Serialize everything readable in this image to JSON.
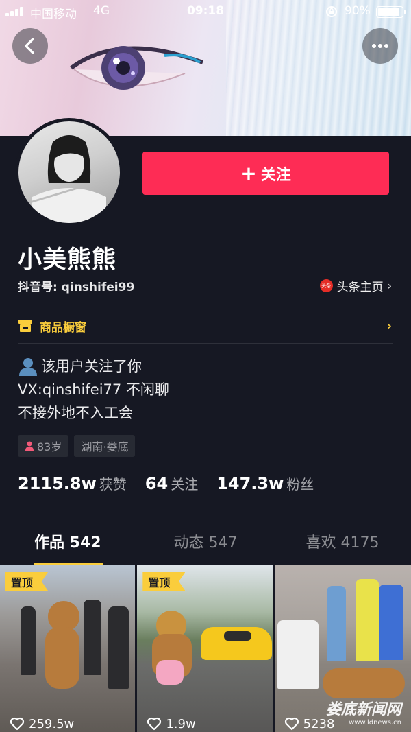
{
  "status_bar": {
    "carrier": "中国移动",
    "network": "4G",
    "time": "09:18",
    "battery": "90%",
    "battery_level": 0.9
  },
  "header": {
    "back_icon": "chevron-left-icon",
    "more_icon": "ellipsis-icon"
  },
  "profile": {
    "follow_label": "关注",
    "follow_plus": "+",
    "name": "小美熊熊",
    "douyin_id": "抖音号: qinshifei99",
    "toutiao_icon_text": "头条",
    "toutiao_label": "头条主页",
    "shop_label": "商品橱窗",
    "bio": [
      "该用户关注了你",
      "VX:qinshifei77  不闲聊",
      "不接外地不入工会"
    ],
    "tags": [
      {
        "gender_icon": "female-icon",
        "text": "83岁"
      },
      {
        "text": "湖南·娄底"
      }
    ],
    "stats": [
      {
        "num": "2115.8w",
        "label": "获赞"
      },
      {
        "num": "64",
        "label": "关注"
      },
      {
        "num": "147.3w",
        "label": "粉丝"
      }
    ]
  },
  "tabs": [
    {
      "label": "作品 542",
      "active": true
    },
    {
      "label": "动态 547",
      "active": false
    },
    {
      "label": "喜欢 4175",
      "active": false
    }
  ],
  "videos": [
    {
      "pinned": "置顶",
      "likes": "259.5w"
    },
    {
      "pinned": "置顶",
      "likes": "1.9w"
    },
    {
      "likes": "5238"
    }
  ],
  "watermark": {
    "main": "娄底新闻网",
    "url": "www.ldnews.cn"
  },
  "colors": {
    "background": "#161823",
    "follow_button": "#fe2c55",
    "accent_yellow": "#facd3c"
  }
}
